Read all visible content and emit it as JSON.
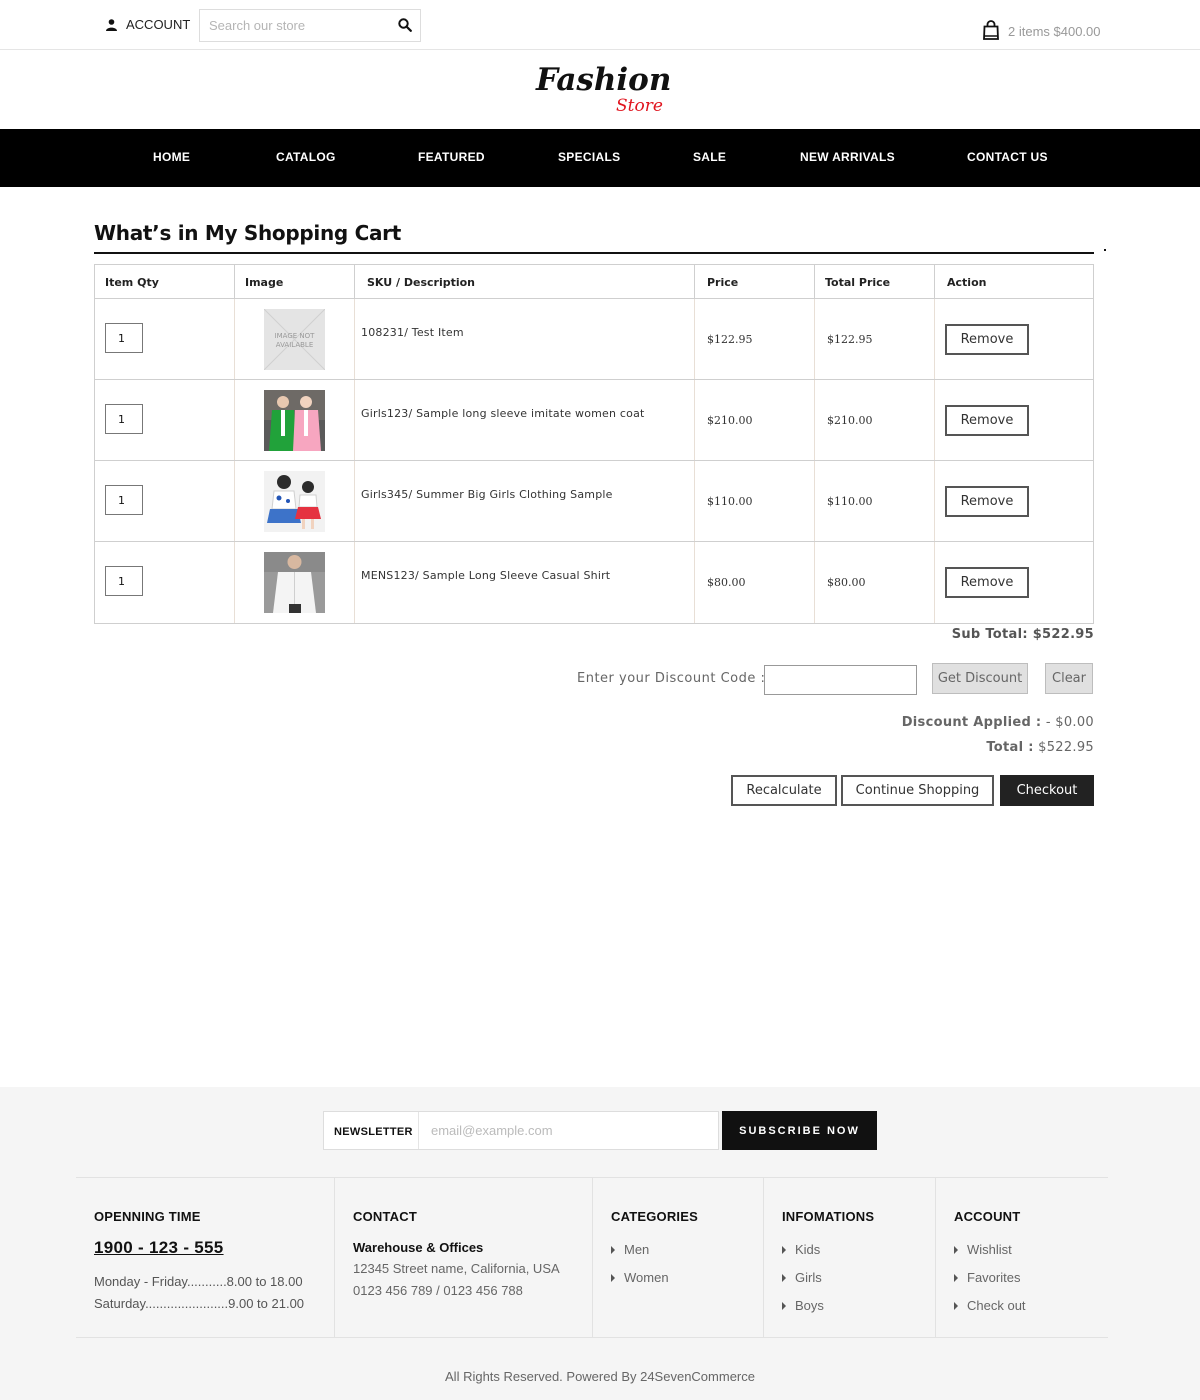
{
  "header": {
    "account_label": "ACCOUNT",
    "search_placeholder": "Search our store",
    "cart_summary": "2 items $400.00"
  },
  "logo": {
    "line1": "Fashion",
    "line2": "Store",
    "accent_color": "#e0141e"
  },
  "nav": {
    "items": [
      {
        "label": "HOME"
      },
      {
        "label": "CATALOG"
      },
      {
        "label": "FEATURED"
      },
      {
        "label": "SPECIALS"
      },
      {
        "label": "SALE"
      },
      {
        "label": "NEW ARRIVALS"
      },
      {
        "label": "CONTACT US"
      }
    ]
  },
  "cart": {
    "title": "What’s in My Shopping Cart",
    "columns": [
      "Item Qty",
      "Image",
      "SKU / Description",
      "Price",
      "Total Price",
      "Action"
    ],
    "rows": [
      {
        "qty": "1",
        "image": "image-not-available",
        "image_text": "IMAGE NOT AVAILABLE",
        "description": "108231/ Test Item",
        "price": "$122.95",
        "total": "$122.95",
        "action": "Remove"
      },
      {
        "qty": "1",
        "image": "women-coat-photo",
        "description": "Girls123/ Sample long sleeve imitate women coat",
        "price": "$210.00",
        "total": "$210.00",
        "action": "Remove"
      },
      {
        "qty": "1",
        "image": "girls-clothing-photo",
        "description": "Girls345/ Summer Big Girls Clothing Sample",
        "price": "$110.00",
        "total": "$110.00",
        "action": "Remove"
      },
      {
        "qty": "1",
        "image": "mens-shirt-photo",
        "description": "MENS123/ Sample Long Sleeve Casual Shirt",
        "price": "$80.00",
        "total": "$80.00",
        "action": "Remove"
      }
    ],
    "subtotal_label": "Sub Total:",
    "subtotal_value": "$522.95",
    "discount_label": "Enter your Discount Code :",
    "discount_value": "",
    "get_discount": "Get Discount",
    "clear": "Clear",
    "discount_applied_label": "Discount Applied :",
    "discount_applied_value": "- $0.00",
    "total_label": "Total :",
    "total_value": "$522.95",
    "recalculate": "Recalculate",
    "continue_shopping": "Continue Shopping",
    "checkout": "Checkout"
  },
  "footer": {
    "newsletter_label": "NEWSLETTER",
    "newsletter_placeholder": "email@example.com",
    "subscribe": "SUBSCRIBE NOW",
    "opening": {
      "title": "OPENNING TIME",
      "phone": "1900 - 123 - 555",
      "line1": "Monday - Friday...........8.00 to 18.00",
      "line2": "Saturday.......................9.00 to 21.00"
    },
    "contact": {
      "title": "CONTACT",
      "subtitle": "Warehouse & Offices",
      "address": "12345 Street name, California, USA",
      "phones": "0123 456 789 / 0123 456 788"
    },
    "categories": {
      "title": "CATEGORIES",
      "items": [
        "Men",
        "Women"
      ]
    },
    "informations": {
      "title": "INFOMATIONS",
      "items": [
        "Kids",
        "Girls",
        "Boys"
      ]
    },
    "account": {
      "title": "ACCOUNT",
      "items": [
        "Wishlist",
        "Favorites",
        "Check out"
      ]
    },
    "copyright": "All Rights Reserved. Powered By 24SevenCommerce"
  }
}
